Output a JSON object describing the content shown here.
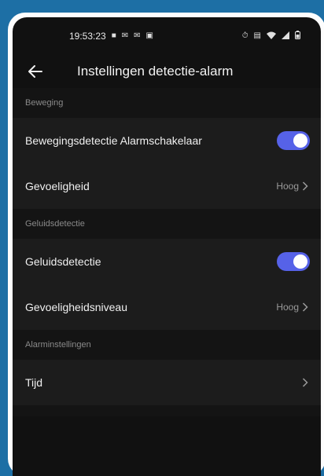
{
  "status_bar": {
    "time": "19:53:23",
    "left_icons": [
      "car-icon",
      "mail-icon",
      "mail-icon",
      "gallery-icon"
    ],
    "right_icons": [
      "alarm-icon",
      "vibrate-icon",
      "wifi-icon",
      "signal-icon",
      "battery-icon"
    ]
  },
  "app_bar": {
    "title": "Instellingen detectie-alarm",
    "back_icon": "back-arrow-icon"
  },
  "sections": [
    {
      "header": "Beweging",
      "rows": [
        {
          "label": "Bewegingsdetectie Alarmschakelaar",
          "type": "toggle",
          "on": true
        },
        {
          "label": "Gevoeligheid",
          "type": "nav",
          "value": "Hoog"
        }
      ]
    },
    {
      "header": "Geluidsdetectie",
      "rows": [
        {
          "label": "Geluidsdetectie",
          "type": "toggle",
          "on": true
        },
        {
          "label": "Gevoeligheidsniveau",
          "type": "nav",
          "value": "Hoog"
        }
      ]
    },
    {
      "header": "Alarminstellingen",
      "rows": [
        {
          "label": "Tijd",
          "type": "nav",
          "value": ""
        }
      ]
    }
  ],
  "colors": {
    "background": "#1d6fa5",
    "screen": "#111111",
    "toggle_on": "#5662e8"
  }
}
